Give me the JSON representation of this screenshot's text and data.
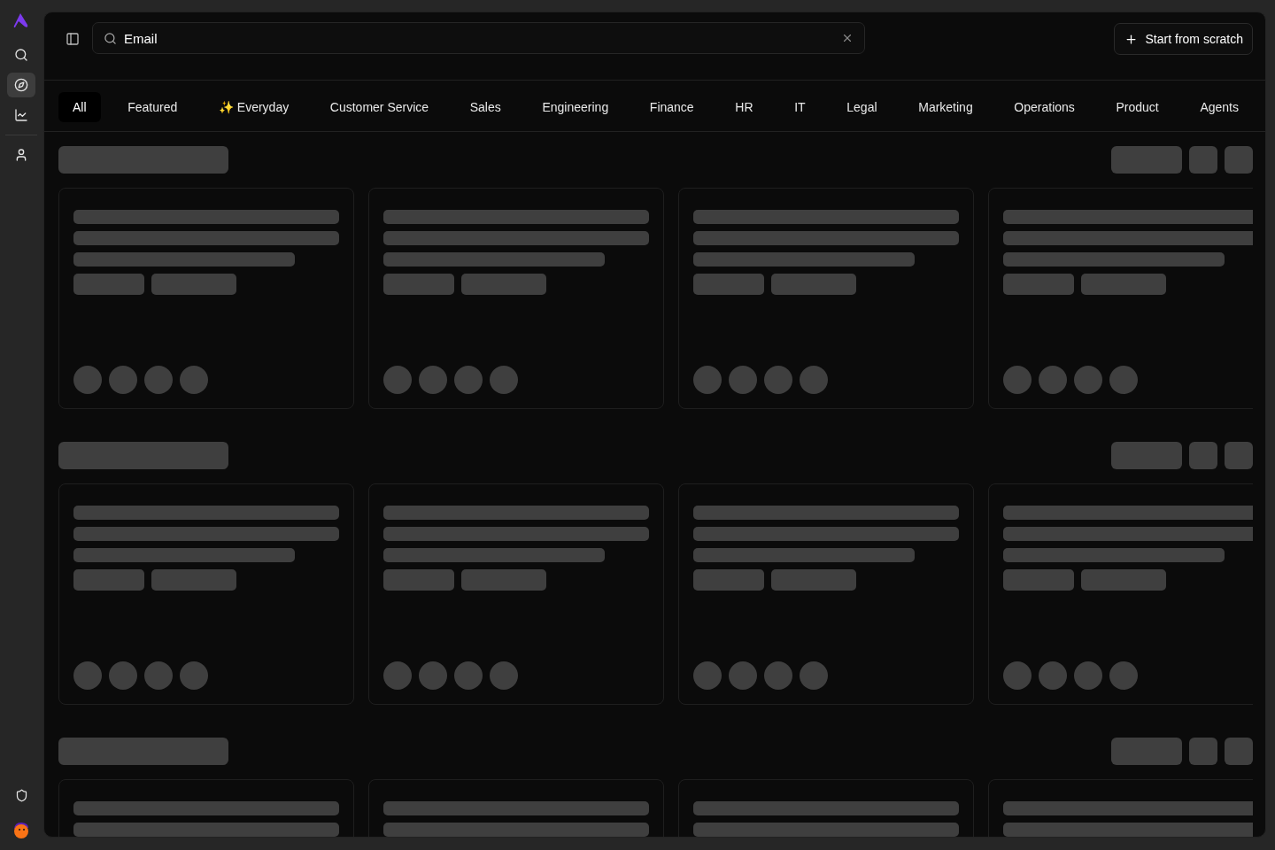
{
  "sidebar": {
    "nav": [
      {
        "kind": "search",
        "selected": false
      },
      {
        "kind": "explore",
        "selected": true
      },
      {
        "kind": "analytics",
        "selected": false
      },
      {
        "kind": "profile",
        "selected": false
      }
    ],
    "bottom": [
      {
        "kind": "security"
      },
      {
        "kind": "avatar"
      }
    ]
  },
  "search": {
    "value": "Email"
  },
  "new_button": {
    "label": "Start from scratch"
  },
  "tabs": [
    {
      "label": "All",
      "selected": true
    },
    {
      "label": "Featured",
      "selected": false
    },
    {
      "label": "✨ Everyday",
      "selected": false
    },
    {
      "label": "Customer Service",
      "selected": false
    },
    {
      "label": "Sales",
      "selected": false
    },
    {
      "label": "Engineering",
      "selected": false
    },
    {
      "label": "Finance",
      "selected": false
    },
    {
      "label": "HR",
      "selected": false
    },
    {
      "label": "IT",
      "selected": false
    },
    {
      "label": "Legal",
      "selected": false
    },
    {
      "label": "Marketing",
      "selected": false
    },
    {
      "label": "Operations",
      "selected": false
    },
    {
      "label": "Product",
      "selected": false
    },
    {
      "label": "Agents",
      "selected": false
    }
  ]
}
